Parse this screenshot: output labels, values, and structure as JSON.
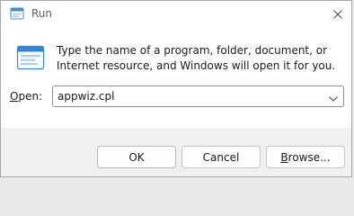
{
  "window": {
    "title": "Run",
    "title_icon": "run-app-icon",
    "close_icon": "close-icon"
  },
  "dialog": {
    "icon": "run-icon",
    "description": "Type the name of a program, folder, document, or Internet resource, and Windows will open it for you.",
    "open_label_accel": "O",
    "open_label_rest": "pen:",
    "open_value": "appwiz.cpl",
    "dropdown_icon": "chevron-down-icon"
  },
  "buttons": {
    "ok": "OK",
    "cancel": "Cancel",
    "browse_accel": "B",
    "browse_rest": "rowse..."
  },
  "colors": {
    "accent": "#0067c0",
    "footer": "#f0f0f0",
    "border": "#8f8f8f"
  }
}
